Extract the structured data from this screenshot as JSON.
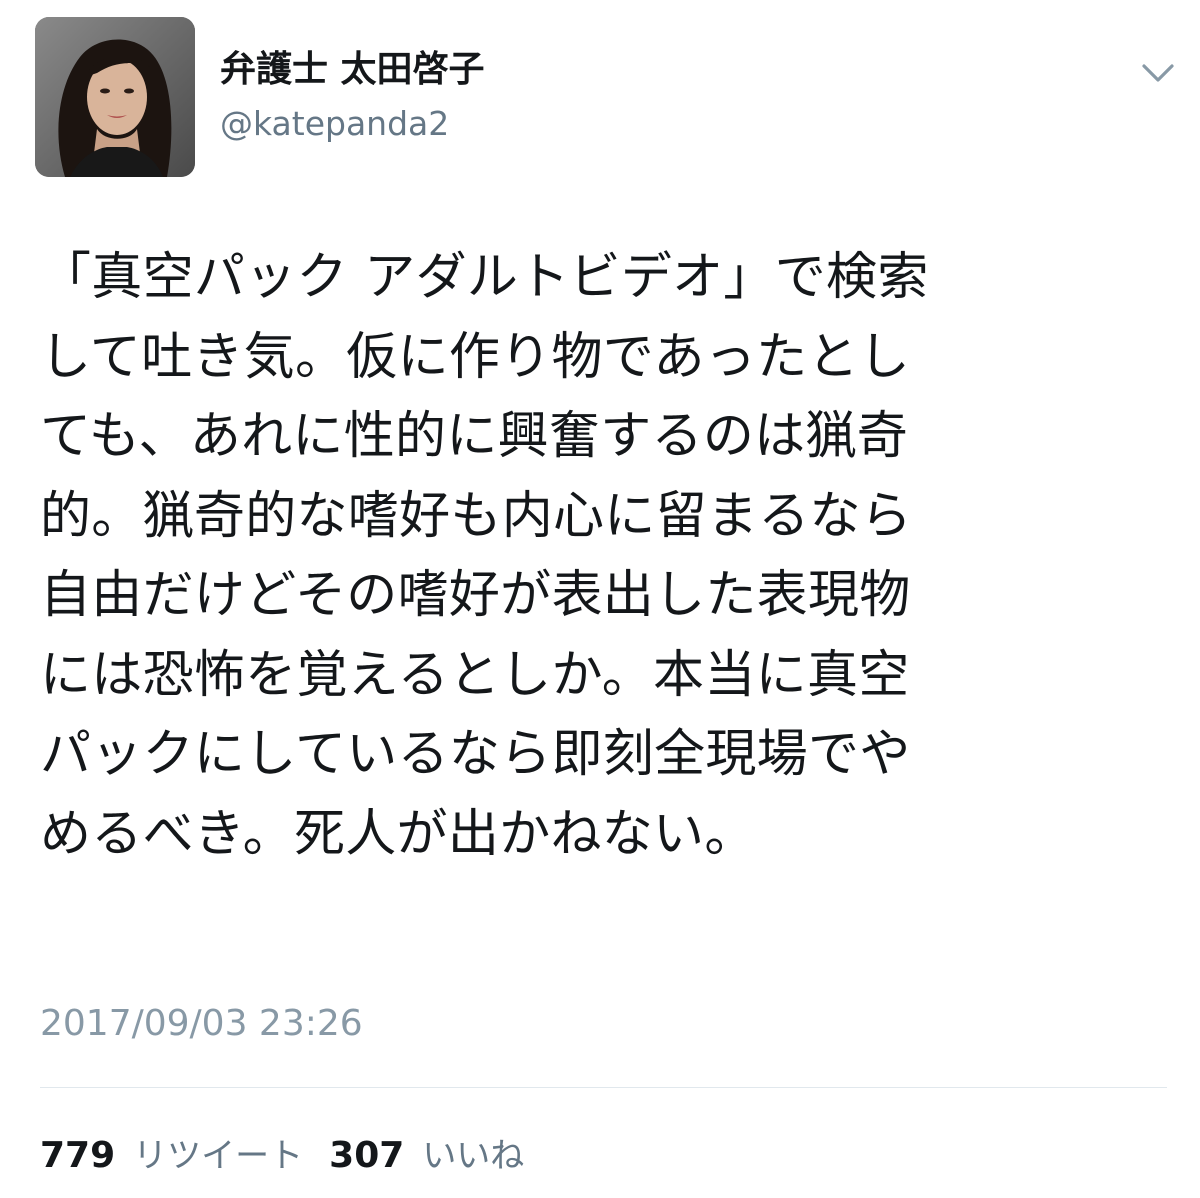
{
  "user": {
    "display_name": "弁護士 太田啓子",
    "handle": "@katepanda2"
  },
  "tweet": {
    "lines": [
      "「真空パック アダルトビデオ」で検索",
      "して吐き気。仮に作り物であったとし",
      "ても、あれに性的に興奮するのは猟奇",
      "的。猟奇的な嗜好も内心に留まるなら",
      "自由だけどその嗜好が表出した表現物",
      "には恐怖を覚えるとしか。本当に真空",
      "パックにしているなら即刻全現場でや",
      "めるべき。死人が出かねない。"
    ],
    "timestamp": "2017/09/03 23:26"
  },
  "stats": {
    "retweets": {
      "count": "779",
      "label": "リツイート"
    },
    "likes": {
      "count": "307",
      "label": "いいね"
    }
  },
  "icons": {
    "menu": "chevron-down-icon"
  },
  "colors": {
    "text": "#14171a",
    "secondary": "#657786",
    "timestamp": "#8899a6",
    "divider": "#e1e8ed"
  }
}
